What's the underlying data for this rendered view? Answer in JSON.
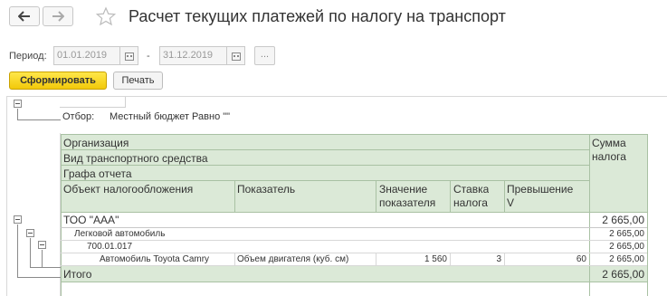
{
  "toolbar": {
    "back_icon": "arrow-left-icon",
    "forward_icon": "arrow-right-icon",
    "favorite_icon": "star-icon"
  },
  "page_title": "Расчет текущих платежей по налогу на транспорт",
  "period": {
    "label": "Период:",
    "from": "01.01.2019",
    "separator": "-",
    "to": "31.12.2019",
    "more_label": "..."
  },
  "actions": {
    "generate_label": "Сформировать",
    "print_label": "Печать"
  },
  "report": {
    "filter_label": "Отбор:",
    "filter_value": "Местный бюджет Равно \"\"",
    "headers": {
      "organization": "Организация",
      "vehicle_type": "Вид транспортного средства",
      "report_column": "Графа отчета",
      "taxation_object": "Объект налогообложения",
      "indicator": "Показатель",
      "indicator_value_1": "Значение",
      "indicator_value_2": "показателя",
      "tax_rate_1": "Ставка",
      "tax_rate_2": "налога",
      "excess_1": "Превышение",
      "excess_2": "V",
      "amount_1": "Сумма",
      "amount_2": "налога"
    },
    "rows": {
      "organization": {
        "name": "ТОО \"ААА\"",
        "amount": "2 665,00"
      },
      "vehicle_type": {
        "name": "Легковой автомобиль",
        "amount": "2 665,00"
      },
      "report_column": {
        "name": "700.01.017",
        "amount": "2 665,00"
      },
      "detail": {
        "object": "Автомобиль Toyota Camry",
        "indicator": "Объем двигателя (куб. см)",
        "value": "1 560",
        "rate": "3",
        "excess": "60",
        "amount": "2 665,00"
      },
      "total": {
        "label": "Итого",
        "amount": "2 665,00"
      }
    }
  },
  "colors": {
    "header_bg": "#dbe9d7",
    "total_bg": "#dbe9d7",
    "primary_button": "#f5d41a"
  }
}
